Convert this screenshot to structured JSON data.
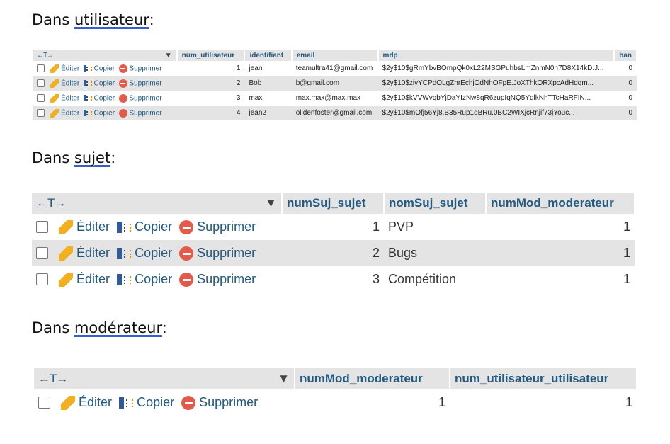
{
  "sections": [
    {
      "prefix": "Dans ",
      "name": "utilisateur",
      "suffix": ":"
    },
    {
      "prefix": "Dans ",
      "name": "sujet",
      "suffix": ":"
    },
    {
      "prefix": "Dans ",
      "name": "modérateur",
      "suffix": ":"
    }
  ],
  "actions": {
    "edit": "Éditer",
    "copy": "Copier",
    "delete": "Supprimer",
    "nav_arrows": "←T→"
  },
  "utilisateur": {
    "columns": [
      "num_utilisateur",
      "identifiant",
      "email",
      "mdp",
      "ban"
    ],
    "rows": [
      [
        "1",
        "jean",
        "teamultra41@gmail.com",
        "$2y$10$gRmYbvBOmpQk0xL22MSGPuhbsLmZnmN0h7D8X14kD.J...",
        "0"
      ],
      [
        "2",
        "Bob",
        "b@gmail.com",
        "$2y$10$ziyYCPdOLgZhrEchjOdNhOFpE.JoXThkORXpcAdHdqm...",
        "0"
      ],
      [
        "3",
        "max",
        "max.max@max.max",
        "$2y$10$kVVWvqbYjDaYIzNw8qR6zupIqNQ5YdlkNhTTcHaRFIN...",
        "0"
      ],
      [
        "4",
        "jean2",
        "olidenfoster@gmail.com",
        "$2y$10$mOfj56Yj8.B35Rup1dBRu.0BC2WIXjcRnjif73jYouc...",
        "0"
      ]
    ]
  },
  "sujet": {
    "columns": [
      "numSuj_sujet",
      "nomSuj_sujet",
      "numMod_moderateur"
    ],
    "rows": [
      [
        "1",
        "PVP",
        "1"
      ],
      [
        "2",
        "Bugs",
        "1"
      ],
      [
        "3",
        "Compétition",
        "1"
      ]
    ]
  },
  "moderateur": {
    "columns": [
      "numMod_moderateur",
      "num_utilisateur_utilisateur"
    ],
    "rows": [
      [
        "1",
        "1"
      ]
    ]
  }
}
